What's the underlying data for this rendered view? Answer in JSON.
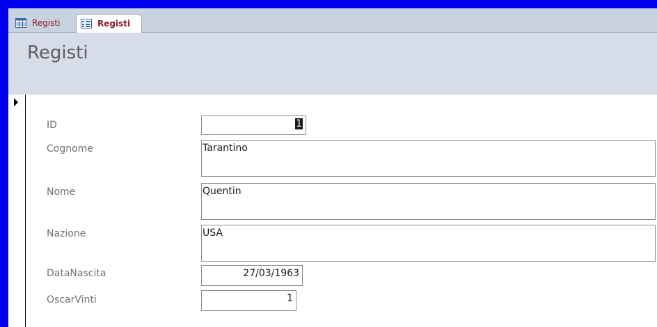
{
  "tabs": [
    {
      "label": "Registi",
      "icon": "table-icon",
      "active": false
    },
    {
      "label": "Registi",
      "icon": "form-icon",
      "active": true
    }
  ],
  "form": {
    "title": "Registi",
    "fields": {
      "id": {
        "label": "ID",
        "value": "1"
      },
      "cognome": {
        "label": "Cognome",
        "value": "Tarantino"
      },
      "nome": {
        "label": "Nome",
        "value": "Quentin"
      },
      "nazione": {
        "label": "Nazione",
        "value": "USA"
      },
      "data_nascita": {
        "label": "DataNascita",
        "value": "27/03/1963"
      },
      "oscar_vinti": {
        "label": "OscarVinti",
        "value": "1"
      }
    }
  },
  "colors": {
    "window_border": "#0000ee",
    "tab_text": "#8b1c2e",
    "header_bg": "#d6dde8",
    "label_text": "#707070"
  }
}
